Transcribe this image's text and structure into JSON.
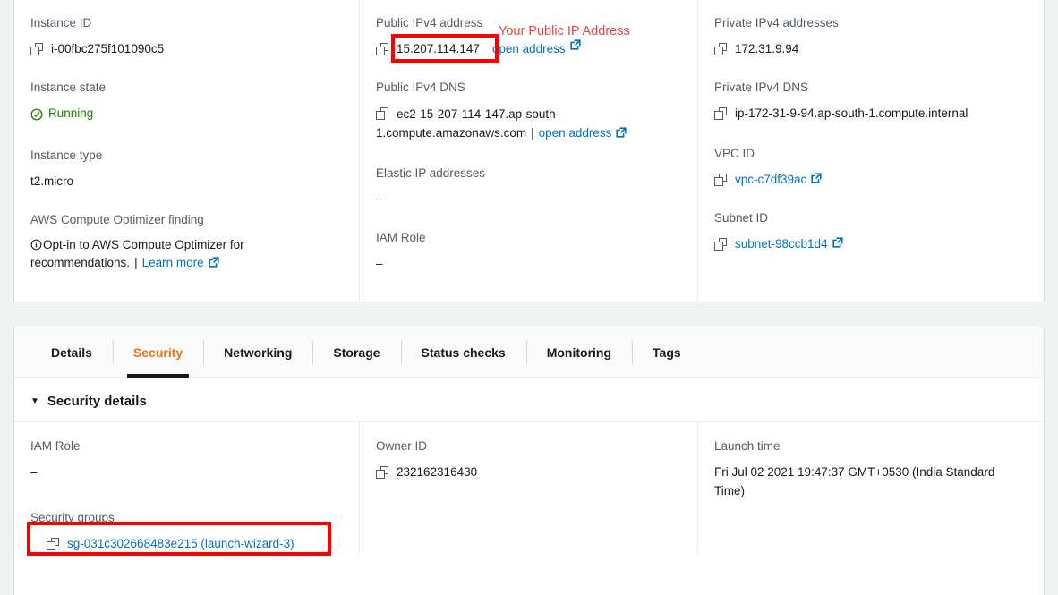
{
  "summary": {
    "col1": [
      {
        "label": "Instance ID",
        "value": "i-00fbc275f101090c5",
        "icon": "copy-icon",
        "type": "copy"
      },
      {
        "label": "Instance state",
        "value": "Running",
        "icon": "status-running-icon",
        "type": "status"
      },
      {
        "label": "Instance type",
        "value": "t2.micro",
        "type": "text"
      },
      {
        "label": "AWS Compute Optimizer finding",
        "value": "Opt-in to AWS Compute Optimizer for recommendations.",
        "icon": "info-icon",
        "link_label": "Learn more",
        "type": "note"
      }
    ],
    "col2": [
      {
        "label": "Public IPv4 address",
        "value": "15.207.114.147",
        "icon": "copy-icon",
        "link_label": "open address",
        "type": "copy-link-nobar"
      },
      {
        "label": "Public IPv4 DNS",
        "value": "ec2-15-207-114-147.ap-south-1.compute.amazonaws.com",
        "icon": "copy-icon",
        "link_label": "open address",
        "type": "copy-link"
      },
      {
        "label": "Elastic IP addresses",
        "value": "–",
        "type": "dash"
      },
      {
        "label": "IAM Role",
        "value": "–",
        "type": "dash"
      }
    ],
    "col3": [
      {
        "label": "Private IPv4 addresses",
        "value": "172.31.9.94",
        "icon": "copy-icon",
        "type": "copy"
      },
      {
        "label": "Private IPv4 DNS",
        "value": "ip-172-31-9-94.ap-south-1.compute.internal",
        "icon": "copy-icon",
        "type": "copy"
      },
      {
        "label": "VPC ID",
        "value": "vpc-c7df39ac",
        "icon": "copy-icon",
        "type": "copy-linkvalue"
      },
      {
        "label": "Subnet ID",
        "value": "subnet-98ccb1d4",
        "icon": "copy-icon",
        "type": "copy-linkvalue"
      }
    ]
  },
  "tabs": [
    {
      "label": "Details",
      "active": false
    },
    {
      "label": "Security",
      "active": true
    },
    {
      "label": "Networking",
      "active": false
    },
    {
      "label": "Storage",
      "active": false
    },
    {
      "label": "Status checks",
      "active": false
    },
    {
      "label": "Monitoring",
      "active": false
    },
    {
      "label": "Tags",
      "active": false
    }
  ],
  "security": {
    "section_title": "Security details",
    "caret": "▼",
    "iam_role": {
      "label": "IAM Role",
      "value": "–"
    },
    "security_groups": {
      "label": "Security groups",
      "value": "sg-031c302668483e215 (launch-wizard-3)"
    },
    "owner_id": {
      "label": "Owner ID",
      "value": "232162316430"
    },
    "launch_time": {
      "label": "Launch time",
      "value": "Fri Jul 02 2021 19:47:37 GMT+0530 (India Standard Time)"
    }
  },
  "annotations": {
    "public_ip_note": "Your Public IP Address"
  },
  "colors": {
    "page_background": "#f1f3f3",
    "panel_background": "#ffffff",
    "panel_border": "#d5dbdb",
    "label_gray": "#545b64",
    "link_blue": "#0073bb",
    "active_tab_orange": "#ec7211",
    "running_green": "#1d8102",
    "annotation_red": "#f4403a",
    "highlight_box_red": "#fd0000"
  }
}
